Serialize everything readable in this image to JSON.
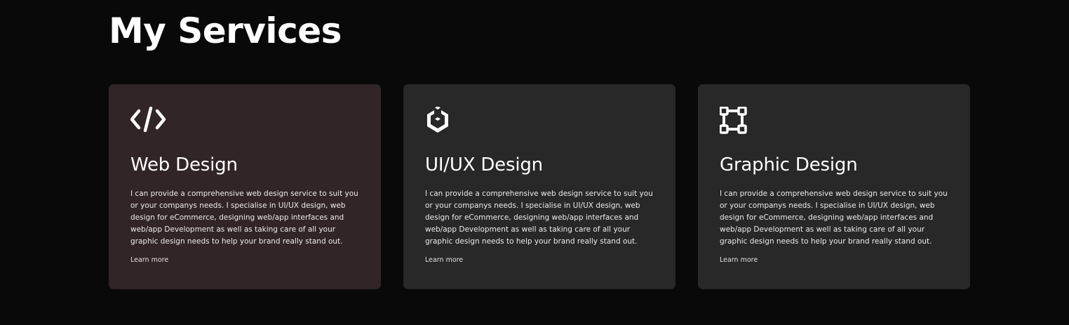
{
  "page": {
    "title": "My Services"
  },
  "services": [
    {
      "icon": "code-icon",
      "title": "Web Design",
      "description": "I can provide a comprehensive web design service to suit you or your companys needs. I specialise in UI/UX design, web design for eCommerce, designing web/app interfaces and web/app Development as well as taking care of all your graphic design needs to help your brand really stand out.",
      "link_label": "Learn more",
      "background": "#322528"
    },
    {
      "icon": "cube-icon",
      "title": "UI/UX Design",
      "description": "I can provide a comprehensive web design service to suit you or your companys needs. I specialise in UI/UX design, web design for eCommerce, designing web/app interfaces and web/app Development as well as taking care of all your graphic design needs to help your brand really stand out.",
      "link_label": "Learn more",
      "background": "#282828"
    },
    {
      "icon": "vector-square-icon",
      "title": "Graphic Design",
      "description": "I can provide a comprehensive web design service to suit you or your companys needs. I specialise in UI/UX design, web design for eCommerce, designing web/app interfaces and web/app Development as well as taking care of all your graphic design needs to help your brand really stand out.",
      "link_label": "Learn more",
      "background": "#282828"
    }
  ],
  "colors": {
    "page_background": "#0a090a",
    "text": "#ffffff"
  }
}
